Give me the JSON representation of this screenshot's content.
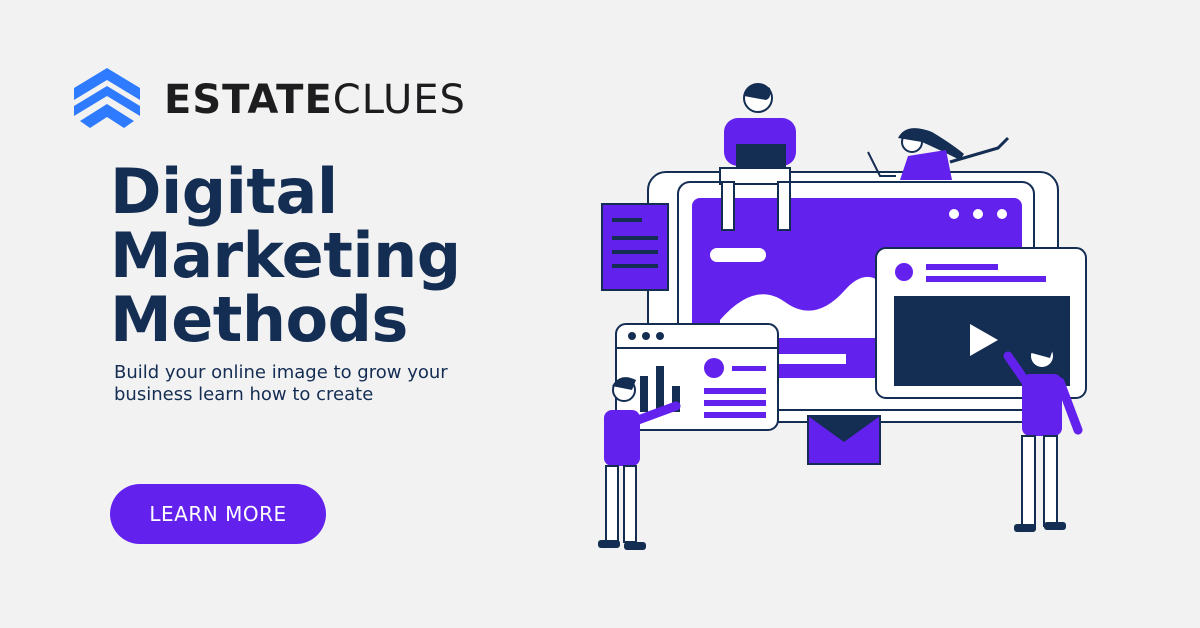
{
  "brand": {
    "name_bold": "ESTATE",
    "name_light": "CLUES",
    "logo_icon": "stacked-chevron-logo",
    "color": "#2f7bff"
  },
  "hero": {
    "headline_lines": [
      "Digital",
      "Marketing",
      "Methods"
    ],
    "subtext_lines": [
      "Build your online image to grow your",
      "business learn how to create"
    ],
    "cta_label": "LEARN MORE"
  },
  "colors": {
    "background": "#f2f2f2",
    "headline": "#142d53",
    "accent": "#6321ee"
  },
  "illustration": {
    "description_icon": "digital-marketing-team-icon"
  }
}
